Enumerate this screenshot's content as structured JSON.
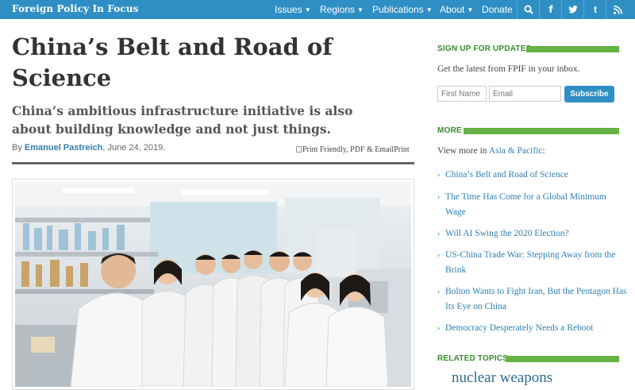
{
  "header": {
    "brand": "Foreign Policy In Focus",
    "nav": [
      {
        "label": "Issues",
        "dropdown": true
      },
      {
        "label": "Regions",
        "dropdown": true
      },
      {
        "label": "Publications",
        "dropdown": true
      },
      {
        "label": "About",
        "dropdown": true
      },
      {
        "label": "Donate",
        "dropdown": false
      }
    ],
    "icons": [
      {
        "name": "search-icon",
        "glyph": "⌕"
      },
      {
        "name": "facebook-icon",
        "glyph": "f"
      },
      {
        "name": "twitter-icon",
        "glyph": "🐦"
      },
      {
        "name": "tumblr-icon",
        "glyph": "t"
      },
      {
        "name": "rss-icon",
        "glyph": "◝"
      }
    ],
    "colors": {
      "bar": "#2f8fc4"
    }
  },
  "article": {
    "title": "China’s Belt and Road of Science",
    "subtitle": "China’s ambitious infrastructure initiative is also about building knowledge and not just things.",
    "by_prefix": "By",
    "author": "Emanuel Pastreich",
    "date": ", June 24, 2019.",
    "print_alt": "Print Friendly, PDF & Email",
    "print_label": "Print"
  },
  "sidebar": {
    "signup": {
      "heading": "SIGN UP FOR UPDATES",
      "text": "Get the latest from FPIF in your inbox.",
      "first_name_placeholder": "First Name",
      "email_placeholder": "Email",
      "button": "Subscribe"
    },
    "more": {
      "heading": "MORE",
      "intro": "View more in",
      "region_link": "Asia & Pacific",
      "intro_suffix": ":",
      "items": [
        "China’s Belt and Road of Science",
        "The Time Has Come for a Global Minimum Wage",
        "Will AI Swing the 2020 Election?",
        "US-China Trade War: Stepping Away from the Brink",
        "Bolton Wants to Fight Iran, But the Pentagon Has Its Eye on China",
        "Democracy Desperately Needs a Reboot"
      ]
    },
    "related": {
      "heading": "RELATED TOPICS",
      "topics": [
        "nuclear weapons"
      ]
    },
    "colors": {
      "accent": "#66b244",
      "heading": "#3a8a2f",
      "link": "#2f7fb0"
    }
  }
}
